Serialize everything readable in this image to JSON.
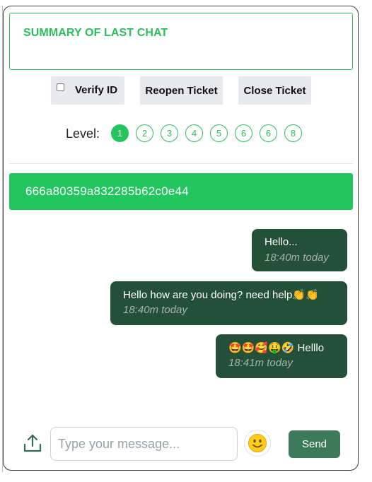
{
  "summary": {
    "title": "SUMMARY OF LAST CHAT"
  },
  "actions": {
    "verify_label": "Verify ID",
    "verify_checked": false,
    "reopen_label": "Reopen Ticket",
    "close_label": "Close Ticket"
  },
  "level": {
    "label": "Level:",
    "selected": "1",
    "options": [
      "1",
      "2",
      "3",
      "4",
      "5",
      "6",
      "6",
      "8"
    ]
  },
  "ticket": {
    "id": "666a80359a832285b62c0e44"
  },
  "messages": [
    {
      "text": "Hello...",
      "time": "18:40m today"
    },
    {
      "text": "Hello how are you doing? need help👏👏",
      "time": "18:40m today"
    },
    {
      "text": "🤩🤩🥰🤑🤣 Helllo",
      "time": "18:41m today"
    }
  ],
  "composer": {
    "placeholder": "Type your message...",
    "value": "",
    "send_label": "Send",
    "upload_icon": "upload-icon",
    "emoji_icon": "smiley-icon"
  },
  "colors": {
    "accent_green": "#22c55e",
    "bubble_dark_green": "#245039",
    "send_button": "#3d7a5c",
    "button_gray": "#e8e9ed"
  }
}
